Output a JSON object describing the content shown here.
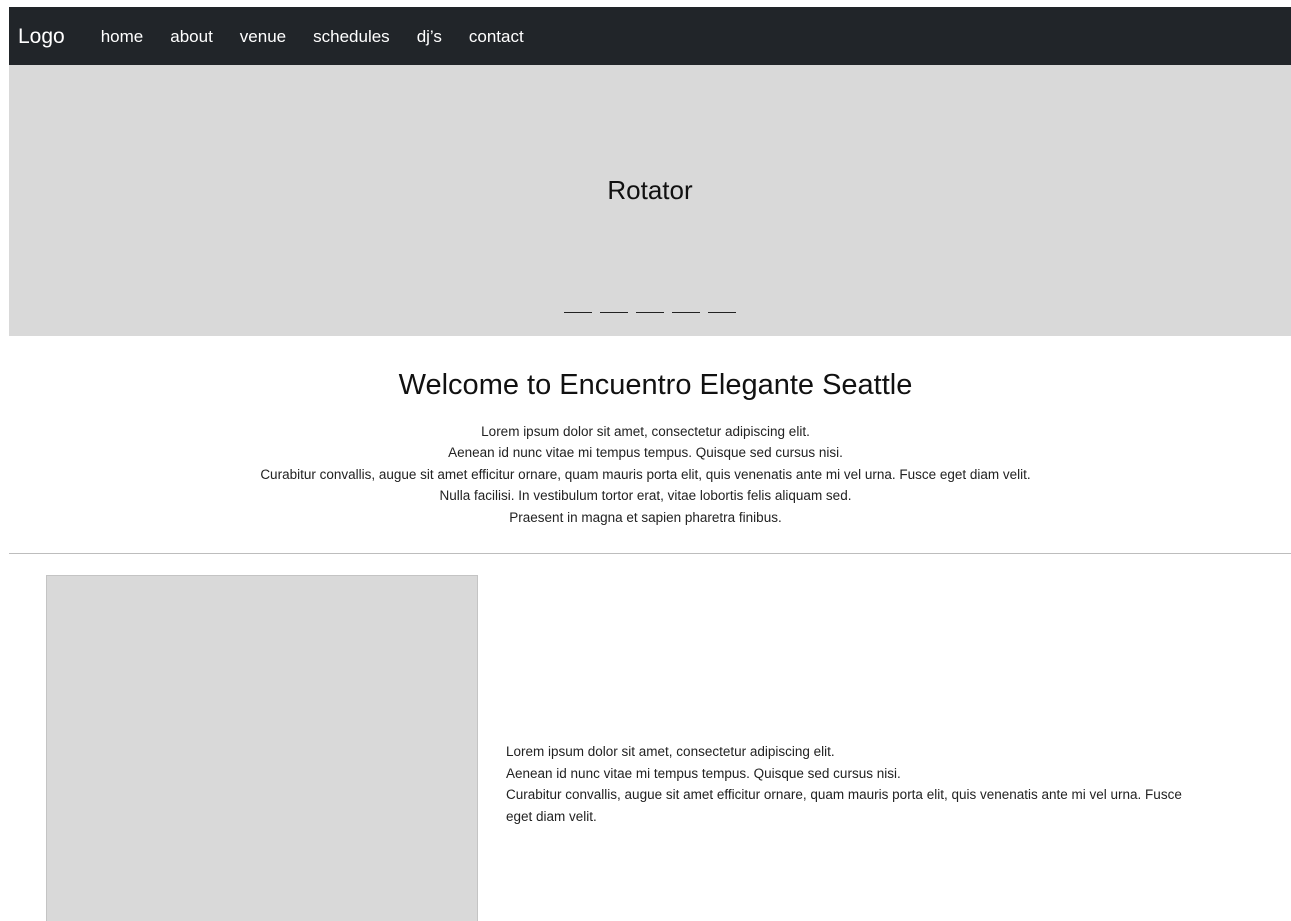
{
  "navbar": {
    "logo": "Logo",
    "links": [
      "home",
      "about",
      "venue",
      "schedules",
      "dj’s",
      "contact"
    ]
  },
  "rotator": {
    "title": "Rotator",
    "indicator_count": 5
  },
  "welcome": {
    "heading": "Welcome to Encuentro Elegante Seattle",
    "lines": [
      "Lorem ipsum dolor sit amet, consectetur adipiscing elit.",
      "Aenean id nunc vitae mi tempus tempus. Quisque sed cursus nisi.",
      "Curabitur convallis, augue sit amet efficitur ornare, quam mauris porta elit, quis venenatis ante mi vel urna. Fusce eget diam velit.",
      "Nulla facilisi. In vestibulum tortor erat, vitae lobortis felis aliquam sed.",
      "Praesent in magna et sapien pharetra finibus."
    ]
  },
  "feature": {
    "lines": [
      "Lorem ipsum dolor sit amet, consectetur adipiscing elit.",
      "Aenean id nunc vitae mi tempus tempus. Quisque sed cursus nisi.",
      "Curabitur convallis, augue sit amet efficitur ornare, quam mauris porta elit, quis venenatis ante mi vel urna. Fusce eget diam velit."
    ]
  },
  "colors": {
    "navbar_bg": "#212529",
    "placeholder_bg": "#d9d9d9",
    "divider": "#bdbdbd"
  }
}
